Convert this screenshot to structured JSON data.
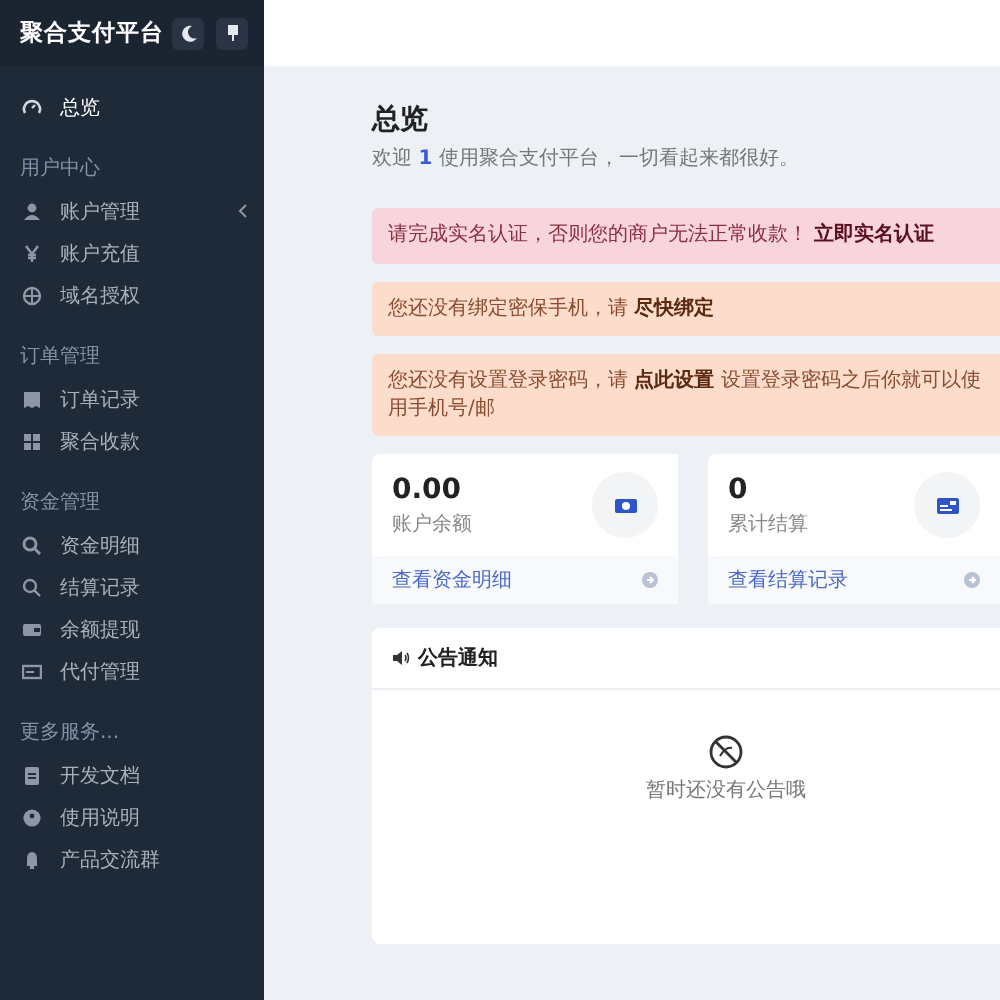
{
  "sidebar": {
    "brand": "聚合支付平台",
    "sections": [
      {
        "items": [
          {
            "label": "总览",
            "selected": true,
            "submenu": false
          }
        ]
      },
      {
        "title": "用户中心",
        "items": [
          {
            "label": "账户管理",
            "selected": false,
            "submenu": true
          },
          {
            "label": "账户充值",
            "selected": false,
            "submenu": false
          },
          {
            "label": "域名授权",
            "selected": false,
            "submenu": false
          }
        ]
      },
      {
        "title": "订单管理",
        "items": [
          {
            "label": "订单记录",
            "selected": false,
            "submenu": false
          },
          {
            "label": "聚合收款",
            "selected": false,
            "submenu": false
          }
        ]
      },
      {
        "title": "资金管理",
        "items": [
          {
            "label": "资金明细",
            "selected": false,
            "submenu": false
          },
          {
            "label": "结算记录",
            "selected": false,
            "submenu": false
          },
          {
            "label": "余额提现",
            "selected": false,
            "submenu": false
          },
          {
            "label": "代付管理",
            "selected": false,
            "submenu": false
          }
        ]
      },
      {
        "title": "更多服务...",
        "items": [
          {
            "label": "开发文档",
            "selected": false,
            "submenu": false
          },
          {
            "label": "使用说明",
            "selected": false,
            "submenu": false
          },
          {
            "label": "产品交流群",
            "selected": false,
            "submenu": false
          }
        ]
      }
    ]
  },
  "page": {
    "title": "总览",
    "subtitle": "欢迎 **1** 使用聚合支付平台，一切看起来都很好。"
  },
  "alerts": [
    {
      "kind": "danger",
      "text": "请完成实名认证，否则您的商户无法正常收款！  **立即实名认证**"
    },
    {
      "kind": "warning",
      "text": "您还没有绑定密保手机，请 **尽快绑定**"
    },
    {
      "kind": "warning",
      "text": "您还没有设置登录密码，请 **点此设置** 设置登录密码之后你就可以使用手机号/邮"
    }
  ],
  "stats": [
    {
      "value": "0.00",
      "label": "账户余额",
      "link": "查看资金明细"
    },
    {
      "value": "0",
      "label": "累计结算",
      "link": "查看结算记录"
    }
  ],
  "notice": {
    "title": "公告通知",
    "empty": "暂时还没有公告哦"
  }
}
